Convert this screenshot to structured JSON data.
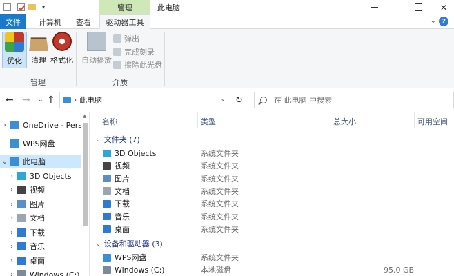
{
  "titlebar": {
    "context_tab_group": "管理",
    "window_title": "此电脑",
    "close_glyph": "✕"
  },
  "ribbon_tabs": [
    "文件",
    "计算机",
    "查看",
    "驱动器工具"
  ],
  "ribbon": {
    "manage_group": {
      "label": "管理",
      "buttons": [
        "优化",
        "清理",
        "格式化"
      ]
    },
    "media_group": {
      "label": "介质",
      "autoplay": "自动播放",
      "eject": "弹出",
      "finish_burning": "完成刻录",
      "erase_disc": "擦除此光盘"
    }
  },
  "address": {
    "path": "此电脑",
    "search_placeholder": "在 此电脑 中搜索"
  },
  "nav": {
    "items": [
      {
        "label": "OneDrive - Persc",
        "color": "#3b8fd6"
      },
      {
        "label": "WPS网盘",
        "color": "#3b8fd6"
      },
      {
        "label": "此电脑",
        "color": "#3b8fd6"
      },
      {
        "label": "3D Objects",
        "color": "#2aa9d8"
      },
      {
        "label": "视频",
        "color": "#444444"
      },
      {
        "label": "图片",
        "color": "#5b8fc7"
      },
      {
        "label": "文档",
        "color": "#9aa6b2"
      },
      {
        "label": "下载",
        "color": "#2f7bd1"
      },
      {
        "label": "音乐",
        "color": "#2f7bd1"
      },
      {
        "label": "桌面",
        "color": "#2f7bd1"
      },
      {
        "label": "Windows (C:)",
        "color": "#7c8a99"
      }
    ]
  },
  "content": {
    "columns": [
      "名称",
      "类型",
      "总大小",
      "可用空间"
    ],
    "groups": [
      {
        "title": "文件夹 (7)",
        "rows": [
          {
            "name": "3D Objects",
            "type": "系统文件夹",
            "size": "",
            "color": "#2aa9d8"
          },
          {
            "name": "视频",
            "type": "系统文件夹",
            "size": "",
            "color": "#444444"
          },
          {
            "name": "图片",
            "type": "系统文件夹",
            "size": "",
            "color": "#5b8fc7"
          },
          {
            "name": "文档",
            "type": "系统文件夹",
            "size": "",
            "color": "#9aa6b2"
          },
          {
            "name": "下载",
            "type": "系统文件夹",
            "size": "",
            "color": "#2f7bd1"
          },
          {
            "name": "音乐",
            "type": "系统文件夹",
            "size": "",
            "color": "#2f7bd1"
          },
          {
            "name": "桌面",
            "type": "系统文件夹",
            "size": "",
            "color": "#2f7bd1"
          }
        ]
      },
      {
        "title": "设备和驱动器 (3)",
        "rows": [
          {
            "name": "WPS网盘",
            "type": "系统文件夹",
            "size": "",
            "color": "#3b8fd6"
          },
          {
            "name": "Windows (C:)",
            "type": "本地磁盘",
            "size": "95.0 GB",
            "color": "#7c8a99"
          }
        ]
      }
    ]
  }
}
